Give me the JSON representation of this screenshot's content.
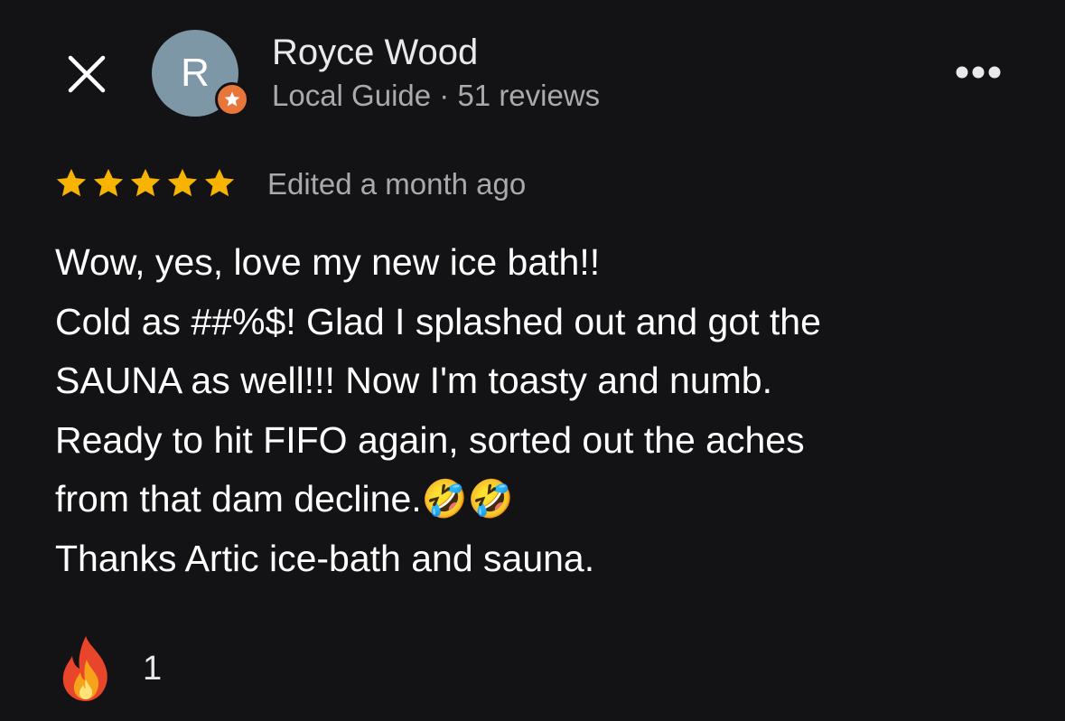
{
  "header": {
    "close_icon": "close-icon",
    "avatar_initial": "R",
    "badge_icon": "local-guide-star-icon",
    "author_name": "Royce Wood",
    "author_meta": "Local Guide · 51 reviews",
    "more_icon": "more-horizontal-icon"
  },
  "rating": {
    "stars": 5,
    "max_stars": 5,
    "star_color": "#f6b400",
    "edited_text": "Edited a month ago"
  },
  "review": {
    "lines": [
      "Wow, yes, love my new ice bath!!",
      "Cold as ##%$! Glad I splashed out and got the",
      "SAUNA as well!!! Now I'm toasty and numb.",
      "Ready to hit FIFO again, sorted out the aches",
      "from that dam decline.",
      "Thanks Artic ice-bath and sauna."
    ],
    "line5_emoji": "🤣🤣"
  },
  "reactions": {
    "icon": "fire-icon",
    "count": "1"
  },
  "colors": {
    "background": "#131315",
    "avatar": "#7d97a6",
    "badge": "#e8753a",
    "secondary_text": "#a9a9ae"
  }
}
